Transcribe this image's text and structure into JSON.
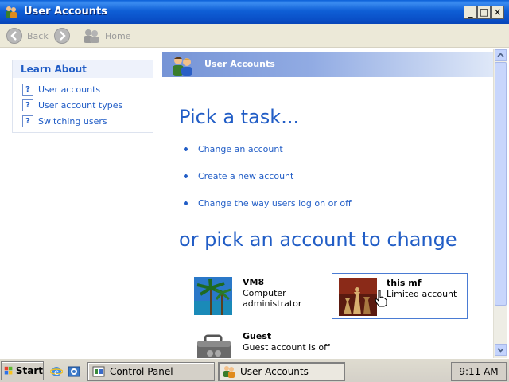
{
  "window": {
    "title": "User Accounts",
    "controls": {
      "minimize": "_",
      "maximize": "□",
      "close": "×"
    }
  },
  "toolbar": {
    "back_label": "Back",
    "home_label": "Home"
  },
  "learn_about": {
    "heading": "Learn About",
    "items": [
      {
        "label": "User accounts",
        "icon": "help-icon"
      },
      {
        "label": "User account types",
        "icon": "help-icon"
      },
      {
        "label": "Switching users",
        "icon": "help-icon"
      }
    ]
  },
  "banner": {
    "title": "User Accounts",
    "icon": "users-icon"
  },
  "main": {
    "pick_heading": "Pick a task...",
    "tasks": [
      "Change an account",
      "Create a new account",
      "Change the way users log on or off"
    ],
    "accounts_heading": "or pick an account to change",
    "accounts": [
      {
        "name": "VM8",
        "role": "Computer administrator",
        "picture": "palm-trees"
      },
      {
        "name": "this mf",
        "role": "Limited account",
        "picture": "chess-pieces"
      },
      {
        "name": "Guest",
        "role": "Guest account is off",
        "picture": "briefcase"
      }
    ]
  },
  "taskbar": {
    "start_label": "Start",
    "buttons": [
      {
        "label": "Control Panel",
        "icon": "control-panel-icon"
      },
      {
        "label": "User Accounts",
        "icon": "users-icon"
      }
    ],
    "clock": "9:11 AM"
  },
  "colors": {
    "title_bar": "#0a50c8",
    "link": "#215dc6",
    "banner": "#7694d6"
  }
}
